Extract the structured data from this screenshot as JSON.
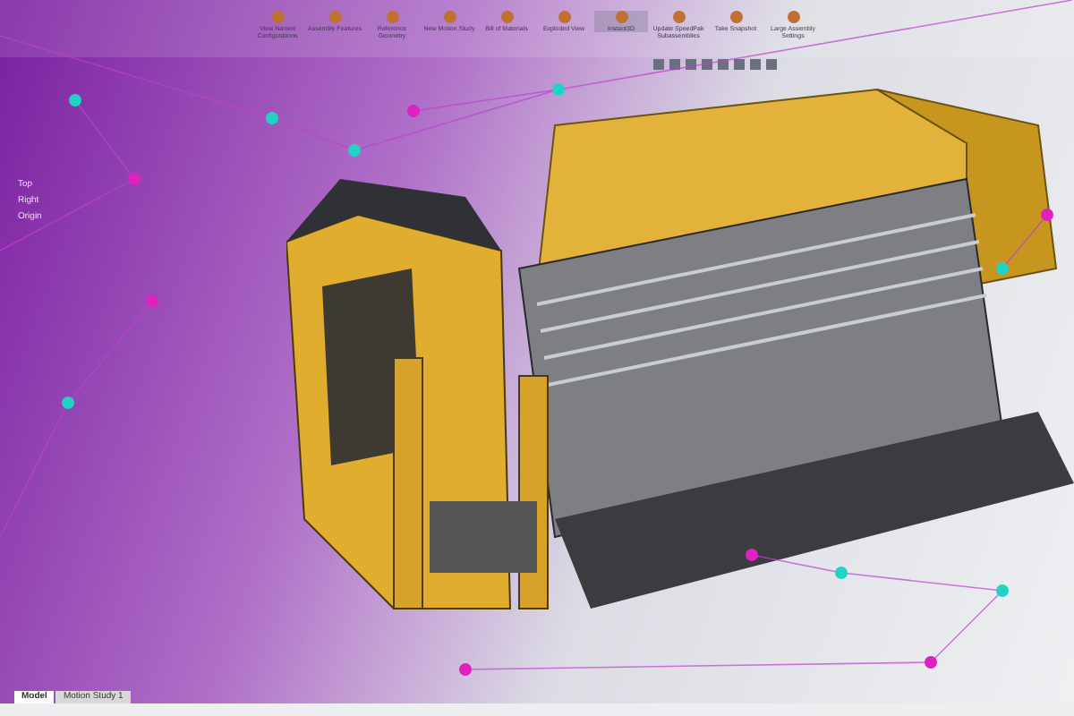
{
  "toolbar": {
    "buttons": [
      {
        "label": "View Named Configurations",
        "selected": false
      },
      {
        "label": "Assembly Features",
        "selected": false
      },
      {
        "label": "Reference Geometry",
        "selected": false
      },
      {
        "label": "New Motion Study",
        "selected": false
      },
      {
        "label": "Bill of Materials",
        "selected": false
      },
      {
        "label": "Exploded View",
        "selected": false
      },
      {
        "label": "Instant3D",
        "selected": true
      },
      {
        "label": "Update SpeedPak Subassemblies",
        "selected": false
      },
      {
        "label": "Take Snapshot",
        "selected": false
      },
      {
        "label": "Large Assembly Settings",
        "selected": false
      }
    ]
  },
  "tree": {
    "items": [
      {
        "label": "Top"
      },
      {
        "label": "Right"
      },
      {
        "label": "Origin"
      }
    ]
  },
  "tabs": [
    {
      "label": "Model",
      "selected": true
    },
    {
      "label": "Motion Study 1",
      "selected": false
    }
  ]
}
